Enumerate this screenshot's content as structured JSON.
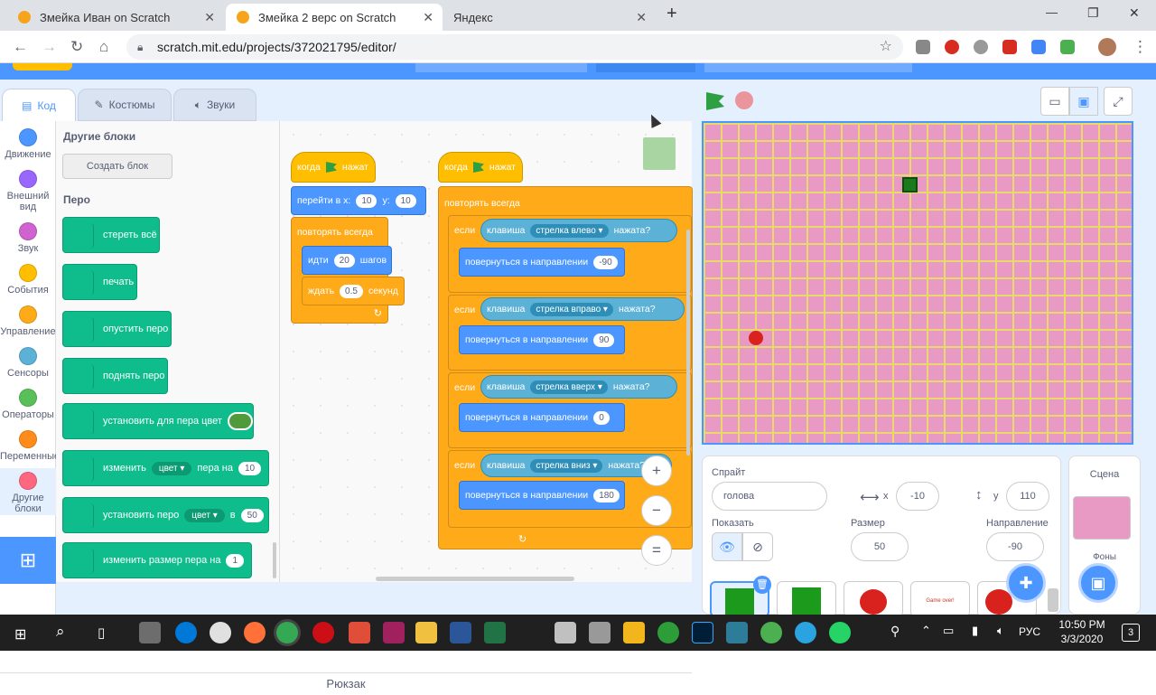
{
  "browser": {
    "tabs": [
      {
        "title": "Змейка Иван on Scratch",
        "close": "✕"
      },
      {
        "title": "Змейка 2 верс on Scratch",
        "close": "✕"
      },
      {
        "title": "Яндекс",
        "close": "✕"
      }
    ],
    "new_tab": "+",
    "url": "scratch.mit.edu/projects/372021795/editor/",
    "window_controls": [
      "—",
      "❐",
      "✕"
    ]
  },
  "editor_tabs": [
    {
      "label": "Код",
      "icon": "code-icon"
    },
    {
      "label": "Костюмы",
      "icon": "brush-icon"
    },
    {
      "label": "Звуки",
      "icon": "speaker-icon"
    }
  ],
  "categories": [
    {
      "label": "Движение",
      "color": "#4c97ff"
    },
    {
      "label": "Внешний вид",
      "color": "#9966ff"
    },
    {
      "label": "Звук",
      "color": "#cf63cf"
    },
    {
      "label": "События",
      "color": "#ffbf00"
    },
    {
      "label": "Управление",
      "color": "#ffab19"
    },
    {
      "label": "Сенсоры",
      "color": "#5cb1d6"
    },
    {
      "label": "Операторы",
      "color": "#59c059"
    },
    {
      "label": "Переменные",
      "color": "#ff8c1a"
    },
    {
      "label": "Другие блоки",
      "color": "#ff6680"
    }
  ],
  "palette": {
    "section_other": "Другие блоки",
    "make_block": "Создать блок",
    "section_pen": "Перо",
    "blocks": {
      "clear": "стереть всё",
      "stamp": "печать",
      "pen_down": "опустить перо",
      "pen_up": "поднять перо",
      "set_color": "установить для пера цвет",
      "change_pre": "изменить",
      "change_drop": "цвет",
      "change_mid": "пера на",
      "change_val": "10",
      "setparam_pre": "установить перо",
      "setparam_drop": "цвет",
      "setparam_mid": "в",
      "setparam_val": "50",
      "size_label": "изменить размер пера на",
      "size_val": "1"
    }
  },
  "script1": {
    "hat_when": "когда",
    "hat_clicked": "нажат",
    "goto": "перейти в x:",
    "goto_x": "10",
    "goto_y_label": "y:",
    "goto_y": "10",
    "forever": "повторять всегда",
    "move": "идти",
    "move_val": "20",
    "move_unit": "шагов",
    "wait": "ждать",
    "wait_val": "0.5",
    "wait_unit": "секунд"
  },
  "script2": {
    "hat_when": "когда",
    "hat_clicked": "нажат",
    "forever": "повторять всегда",
    "if_label": "если",
    "key_label": "клавиша",
    "pressed": "нажата?",
    "turn_label": "повернуться в направлении",
    "cases": [
      {
        "key": "стрелка влево",
        "dir": "-90"
      },
      {
        "key": "стрелка вправо",
        "dir": "90"
      },
      {
        "key": "стрелка вверх",
        "dir": "0"
      },
      {
        "key": "стрелка вниз",
        "dir": "180"
      }
    ]
  },
  "zoom": {
    "in": "+",
    "out": "−",
    "reset": "="
  },
  "sprite": {
    "label": "Спрайт",
    "name": "голова",
    "x_label": "x",
    "x": "-10",
    "y_label": "y",
    "y": "110",
    "show_label": "Показать",
    "size_label": "Размер",
    "size": "50",
    "dir_label": "Направление",
    "dir": "-90",
    "thumb_text": "Game over!"
  },
  "scene": {
    "label": "Сцена",
    "backdrops": "Фоны"
  },
  "backpack": "Рюкзак",
  "taskbar": {
    "lang": "РУС",
    "time": "10:50 PM",
    "date": "3/3/2020",
    "notif": "3"
  },
  "colors": {
    "stage_bg": "#e89ac4",
    "grid": "#e8d96a",
    "scratch_blue": "#4c97ff"
  }
}
